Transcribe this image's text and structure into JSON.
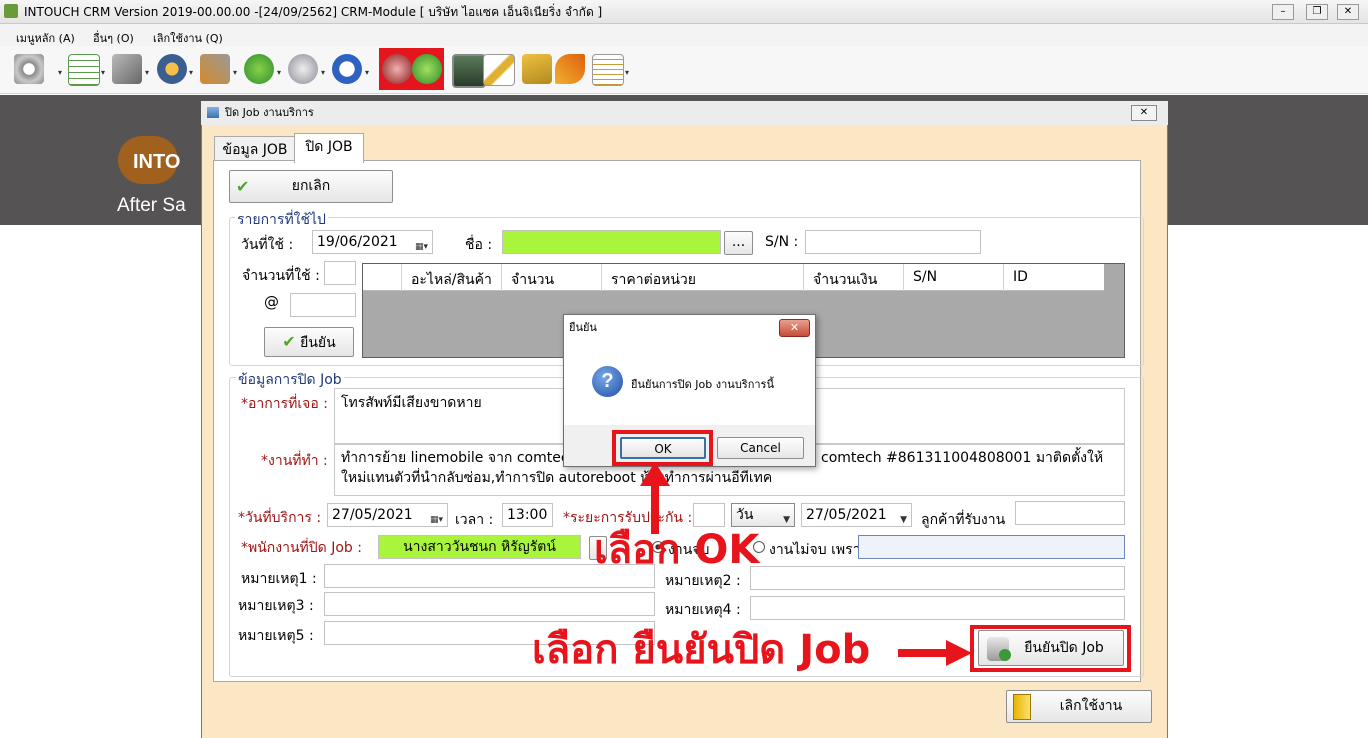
{
  "window": {
    "title": "INTOUCH CRM Version 2019-00.00.00 -[24/09/2562] CRM-Module  [ บริษัท ไอแซค เอ็นจิเนียริ่ง จำกัด ]",
    "minimize": "–",
    "restore": "❐",
    "close": "✕"
  },
  "menu": {
    "main": "เมนูหลัก (A)",
    "other": "อื่นๆ (O)",
    "quit": "เลิกใช้งาน (Q)"
  },
  "toolbar": {
    "icons": [
      "gear-icon",
      "table-icon",
      "tools-icon",
      "headset-icon",
      "wrench-icon",
      "download-icon",
      "satellite-icon",
      "refresh-icon",
      "support-icon",
      "arrow-icon",
      "monitor-icon",
      "edit-icon",
      "mail-icon",
      "pin-icon",
      "report-icon"
    ],
    "dropdown_glyph": "▾"
  },
  "banner": {
    "logo_text": "INTO",
    "tagline": "After Sa"
  },
  "dialog": {
    "title": "ปิด Job งานบริการ",
    "close": "✕",
    "tabs": [
      "ข้อมูล JOB",
      "ปิด JOB"
    ],
    "cancel_button": "ยกเลิก",
    "parts_group": {
      "legend": "รายการที่ใช้ไป",
      "date_label": "วันที่ใช้ :",
      "date_value": "19/06/2021",
      "name_label": "ชื่อ :",
      "name_value": "",
      "browse_button": "...",
      "sn_label": "S/N :",
      "sn_value": "",
      "qty_label": "จำนวนที่ใช้ :",
      "qty_value": "",
      "at_label": "@",
      "at_value": "",
      "confirm_button": "ยืนยัน",
      "grid_columns": [
        "อะไหล่/สินค้า",
        "จำนวน",
        "ราคาต่อหน่วย",
        "จำนวนเงิน",
        "S/N",
        "ID"
      ]
    },
    "close_group": {
      "legend": "ข้อมูลการปิด Job",
      "symptom_label": "*อาการที่เจอ :",
      "symptom_value": "โทรสัพท์มีเสียงขาดหาย",
      "work_label": "*งานที่ทำ :",
      "work_value_left": "ทำการย้าย linemobile จาก comtec",
      "work_value_right": "comtech #861311004808001 มาติดตั้งให้",
      "work_value_line2": "ใหม่แทนตัวที่นำกลับซ่อม,ทำการปิด autoreboot ห้องทำการผ่านอีทีเทค",
      "service_date_label": "*วันที่บริการ :",
      "service_date_value": "27/05/2021",
      "time_label": "เวลา :",
      "time_value": "13:00",
      "warranty_label": "*ระยะการรับประกัน :",
      "warranty_value": "",
      "warranty_unit": "วัน",
      "warranty_date": "27/05/2021",
      "customer_label": "ลูกค้าที่รับงาน",
      "customer_value": "",
      "staff_label": "*พนักงานที่ปิด Job :",
      "staff_value": "นางสาววันชนก หิรัญรัตน์",
      "status_done": "งานจบ",
      "status_not_done": "งานไม่จบ เพราะ",
      "reason_value": "",
      "remark1_label": "หมายเหตุ1 :",
      "remark2_label": "หมายเหตุ2 :",
      "remark3_label": "หมายเหตุ3 :",
      "remark4_label": "หมายเหตุ4 :",
      "remark5_label": "หมายเหตุ5 :",
      "confirm_close_button": "ยืนยันปิด Job"
    },
    "exit_button": "เลิกใช้งาน"
  },
  "messagebox": {
    "title": "ยืนยัน",
    "close": "✕",
    "icon": "?",
    "message": "ยืนยันการปิด Job งานบริการนี้",
    "ok": "OK",
    "cancel": "Cancel"
  },
  "annotations": {
    "ok_callout": "เลือก OK",
    "confirm_callout": "เลือก ยืนยันปิด Job",
    "color": "#e8141c"
  }
}
